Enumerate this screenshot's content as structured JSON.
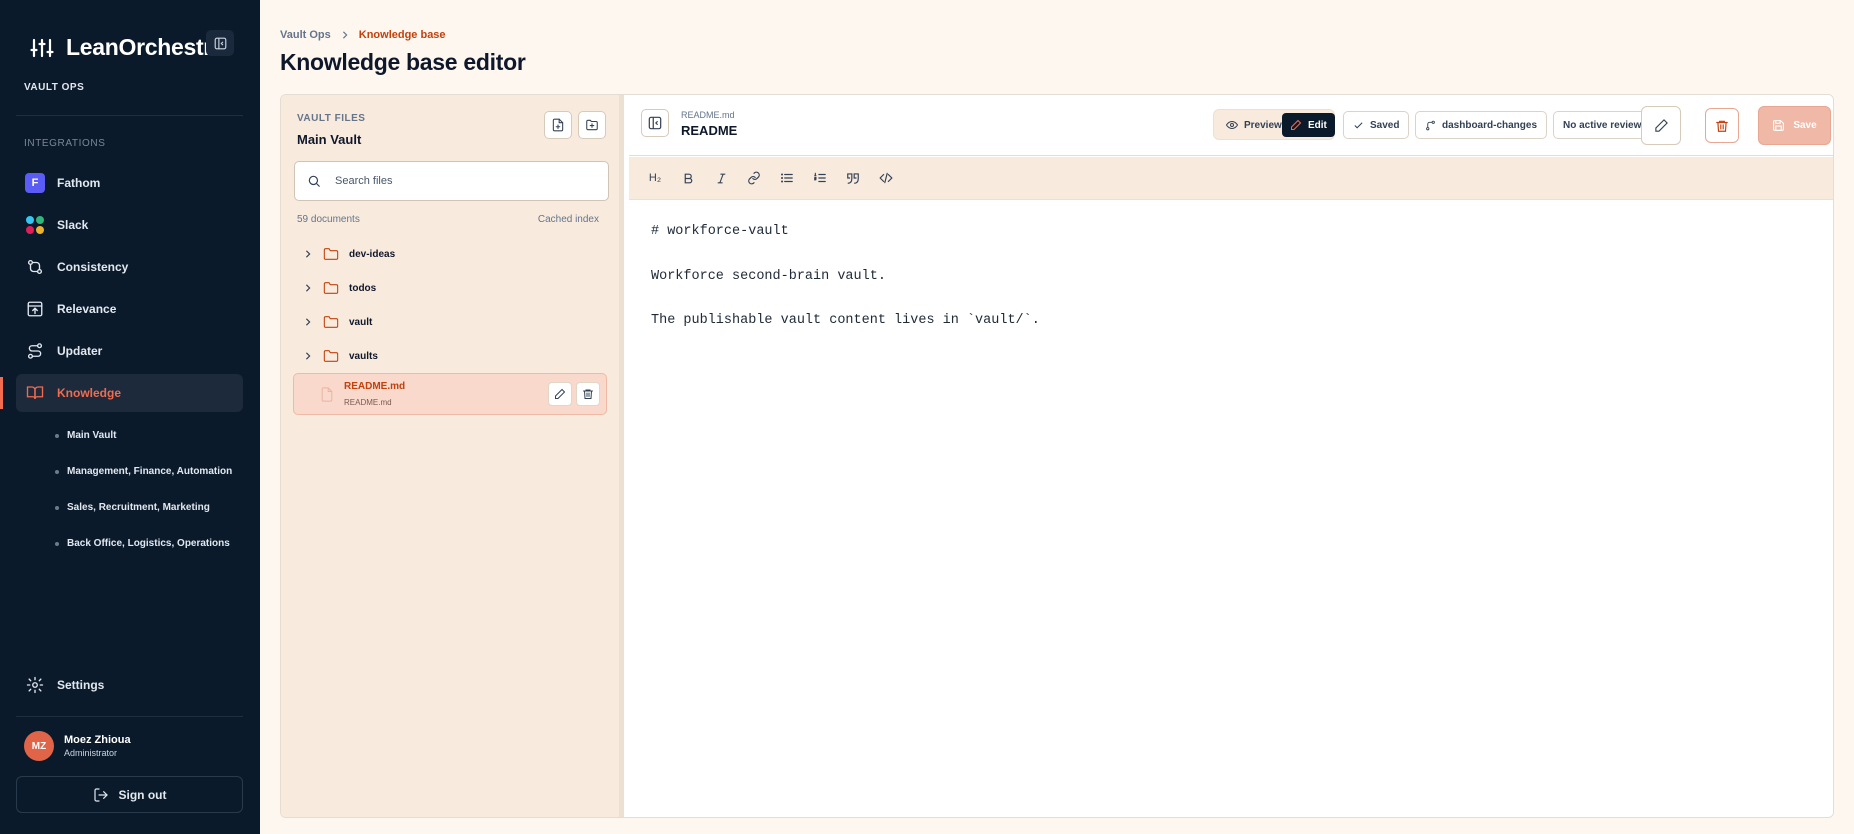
{
  "sidebar": {
    "brand": "LeanOrchestr",
    "workspace": "VAULT OPS",
    "section_label": "INTEGRATIONS",
    "nav": {
      "fathom": "Fathom",
      "fathom_letter": "F",
      "slack": "Slack",
      "consistency": "Consistency",
      "relevance": "Relevance",
      "updater": "Updater",
      "knowledge": "Knowledge",
      "settings": "Settings"
    },
    "sub_items": [
      "Main Vault",
      "Management, Finance, Automation",
      "Sales, Recruitment, Marketing",
      "Back Office, Logistics, Operations"
    ],
    "user": {
      "initials": "MZ",
      "name": "Moez Zhioua",
      "role": "Administrator"
    },
    "sign_out": "Sign out",
    "colors": {
      "background": "#0b1a2b",
      "accent": "#f26b4f"
    }
  },
  "header": {
    "breadcrumb_root": "Vault Ops",
    "breadcrumb_current": "Knowledge base",
    "title": "Knowledge base editor"
  },
  "files": {
    "label": "VAULT FILES",
    "vault_name": "Main Vault",
    "search_placeholder": "Search files",
    "doc_count": "59 documents",
    "cache_status": "Cached index",
    "folders": [
      "dev-ideas",
      "todos",
      "vault",
      "vaults"
    ],
    "selected_file": {
      "title": "README.md",
      "subtitle": "README.md"
    }
  },
  "editor": {
    "file_path": "README.md",
    "doc_title": "README",
    "preview_label": "Preview",
    "edit_label": "Edit",
    "saved_label": "Saved",
    "branch_label": "dashboard-changes",
    "review_label": "No active review",
    "save_label": "Save",
    "format_buttons": [
      "H2",
      "bold",
      "italic",
      "link",
      "bullet-list",
      "numbered-list",
      "quote",
      "code"
    ],
    "heading_button_label": "H₂",
    "content_lines": [
      "# workforce-vault",
      "Workforce second-brain vault.",
      "The publishable vault content lives in `vault/`."
    ]
  }
}
